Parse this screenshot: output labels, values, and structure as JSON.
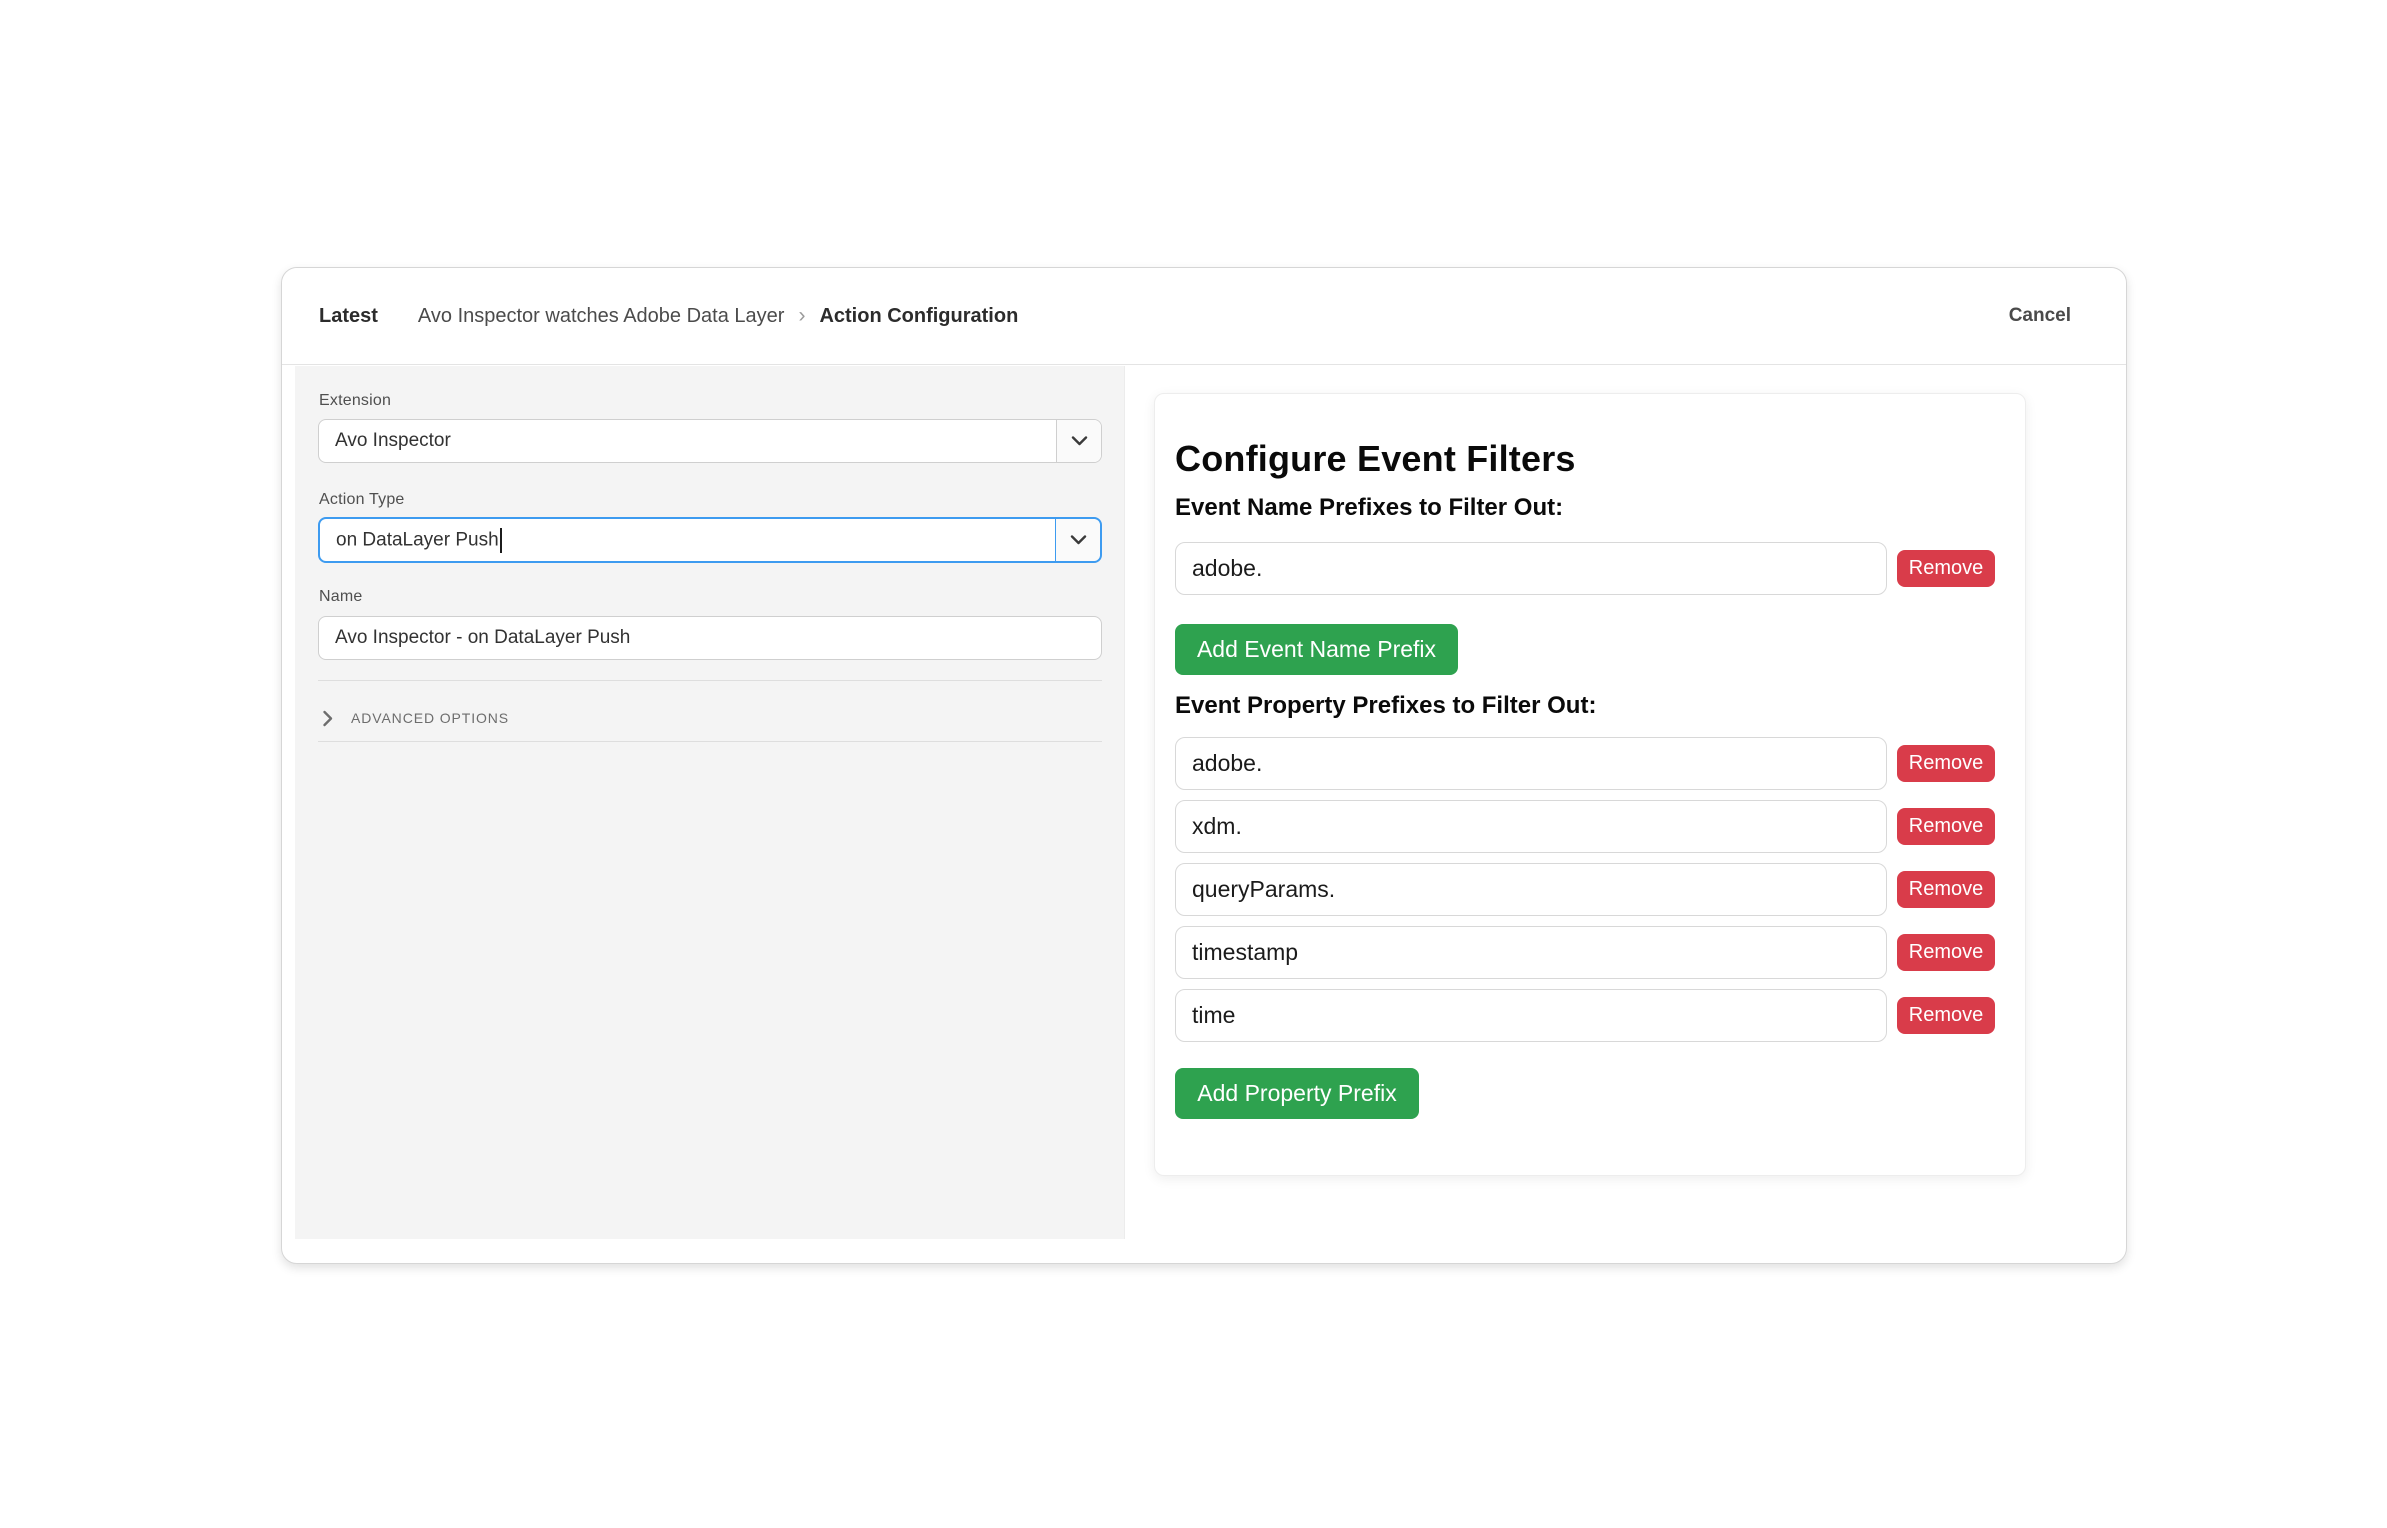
{
  "header": {
    "environment": "Latest",
    "breadcrumb_parent": "Avo Inspector watches Adobe Data Layer",
    "breadcrumb_separator": "›",
    "breadcrumb_current": "Action Configuration",
    "cancel_label": "Cancel"
  },
  "form": {
    "extension": {
      "label": "Extension",
      "value": "Avo Inspector"
    },
    "action_type": {
      "label": "Action Type",
      "value": "on DataLayer Push"
    },
    "name": {
      "label": "Name",
      "value": "Avo Inspector - on DataLayer Push"
    },
    "advanced_options_label": "ADVANCED OPTIONS"
  },
  "filters": {
    "title": "Configure Event Filters",
    "remove_label": "Remove",
    "event_name_section": {
      "label": "Event Name Prefixes to Filter Out:",
      "prefixes": [
        "adobe."
      ],
      "add_label": "Add Event Name Prefix"
    },
    "event_property_section": {
      "label": "Event Property Prefixes to Filter Out:",
      "prefixes": [
        "adobe.",
        "xdm.",
        "queryParams.",
        "timestamp",
        "time"
      ],
      "add_label": "Add Property Prefix"
    }
  },
  "icons": {
    "select_chevron": "chevron-down",
    "advanced_chevron": "chevron-right",
    "text_cursor": "caret"
  },
  "colors": {
    "focus_blue": "#3d9bf0",
    "danger_red": "#d93c4a",
    "success_green": "#2ea24f",
    "panel_gray": "#f4f4f4"
  }
}
